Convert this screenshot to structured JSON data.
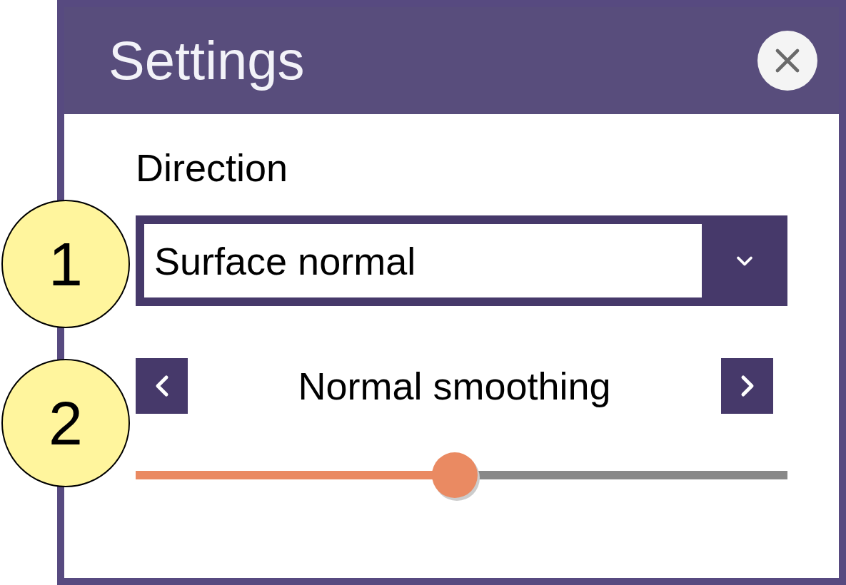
{
  "window": {
    "title": "Settings"
  },
  "direction": {
    "label": "Direction",
    "value": "Surface normal"
  },
  "smoothing": {
    "label": "Normal smoothing",
    "level": 0.49
  },
  "callouts": [
    {
      "label": "1"
    },
    {
      "label": "2"
    }
  ]
}
